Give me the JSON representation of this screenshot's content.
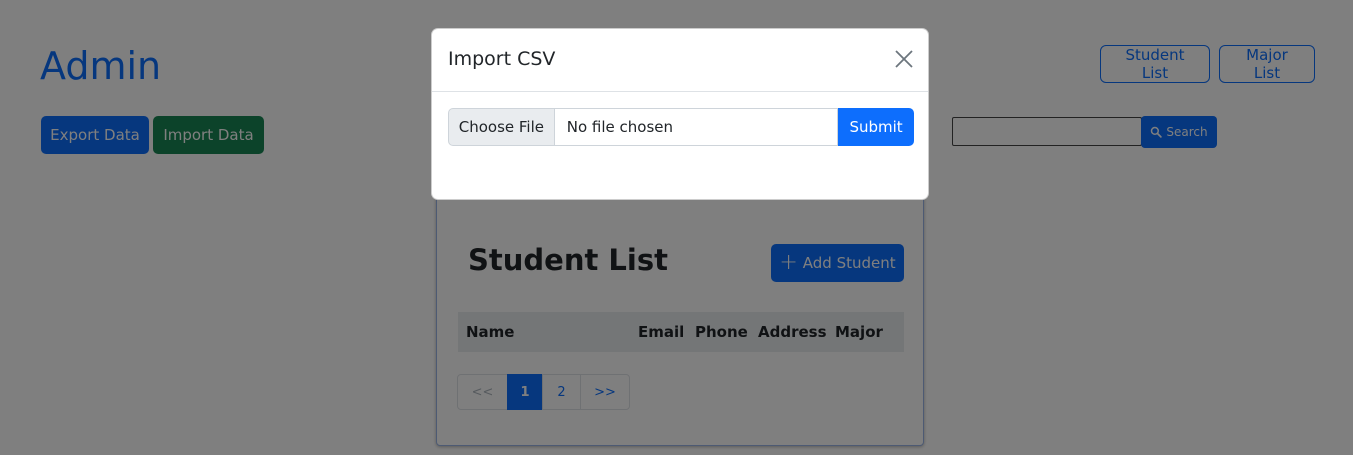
{
  "header": {
    "title": "Admin",
    "nav": [
      {
        "label": "Student List"
      },
      {
        "label": "Major List"
      }
    ]
  },
  "toolbar": {
    "export_label": "Export Data",
    "import_label": "Import Data",
    "search_value": "",
    "search_label": "Search"
  },
  "student_card": {
    "title": "Student List",
    "add_label": "Add Student",
    "columns": [
      "Name",
      "Email",
      "Phone",
      "Address",
      "Major"
    ],
    "pagination": {
      "prev": "<<",
      "pages": [
        "1",
        "2"
      ],
      "active_page": "1",
      "next": ">>"
    }
  },
  "modal": {
    "title": "Import CSV",
    "choose_file_label": "Choose File",
    "file_name": "No file chosen",
    "submit_label": "Submit"
  },
  "colors": {
    "primary": "#0d6efd",
    "success": "#198754",
    "backdrop": "rgba(0,0,0,0.5)"
  }
}
